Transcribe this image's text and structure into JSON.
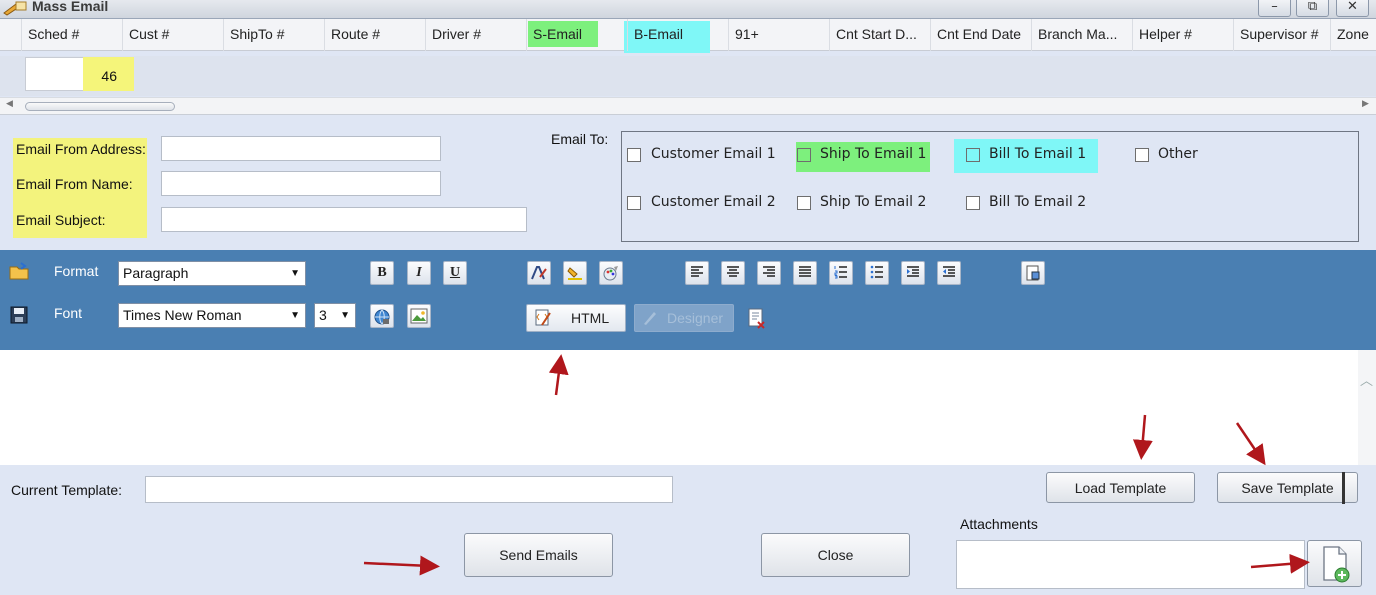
{
  "window": {
    "title": "Mass Email",
    "controls": {
      "minimize": "–",
      "restore": "⧉",
      "close": "✕"
    }
  },
  "grid": {
    "columns": [
      "Sched #",
      "Cust #",
      "ShipTo #",
      "Route #",
      "Driver #",
      "S-Email",
      "B-Email",
      "91+",
      "Cnt Start D...",
      "Cnt End Date",
      "Branch Ma...",
      "Helper #",
      "Supervisor #",
      "Zone"
    ],
    "filter_value": "46"
  },
  "form": {
    "from_address_label": "Email From Address:",
    "from_name_label": "Email From Name:",
    "subject_label": "Email Subject:",
    "from_address_value": "",
    "from_name_value": "",
    "subject_value": "",
    "email_to_label": "Email To:",
    "checkboxes": {
      "customer_email_1": "Customer Email 1",
      "ship_to_email_1": "Ship To Email 1",
      "bill_to_email_1": "Bill To Email 1",
      "other": "Other",
      "customer_email_2": "Customer Email 2",
      "ship_to_email_2": "Ship To Email 2",
      "bill_to_email_2": "Bill To Email 2"
    }
  },
  "toolbar": {
    "format_label": "Format",
    "format_value": "Paragraph",
    "font_label": "Font",
    "font_value": "Times New Roman",
    "size_value": "3",
    "bold": "B",
    "italic": "I",
    "underline": "U",
    "html_button": "HTML",
    "designer_button": "Designer"
  },
  "bottom": {
    "current_template_label": "Current Template:",
    "current_template_value": "",
    "load_template": "Load Template",
    "save_template": "Save Template",
    "attachments_label": "Attachments",
    "send_emails": "Send Emails",
    "close": "Close"
  },
  "colors": {
    "highlight_yellow": "#f3f37d",
    "highlight_green": "#7df07d",
    "highlight_cyan": "#7ff7f7",
    "toolbar_blue": "#4a7fb2",
    "annotation_arrow": "#b0171c"
  }
}
